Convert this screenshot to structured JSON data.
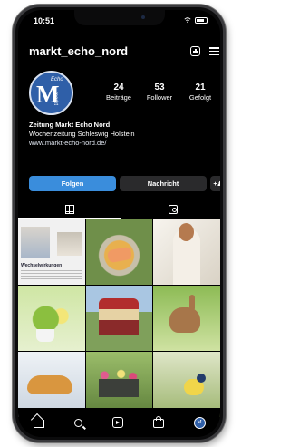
{
  "status": {
    "time": "10:51"
  },
  "header": {
    "username": "markt_echo_nord"
  },
  "avatar": {
    "mark": "M",
    "echo_text": "Echo",
    "markt_text": "markt"
  },
  "stats": [
    {
      "value": "24",
      "label": "Beiträge"
    },
    {
      "value": "53",
      "label": "Follower"
    },
    {
      "value": "21",
      "label": "Gefolgt"
    }
  ],
  "bio": {
    "name": "Zeitung Markt Echo Nord",
    "description": "Wochenzeitung Schleswig Holstein",
    "link": "www.markt-echo-nord.de/"
  },
  "actions": {
    "follow_label": "Folgen",
    "message_label": "Nachricht",
    "add_label": "+♟"
  },
  "posts": {
    "first_headline": "Wechselwirkungen"
  },
  "bottom_nav": {
    "profile_mark": "M"
  },
  "colors": {
    "accent": "#3a8ddc",
    "background": "#000000",
    "avatar_bg": "#2f5fa8"
  }
}
